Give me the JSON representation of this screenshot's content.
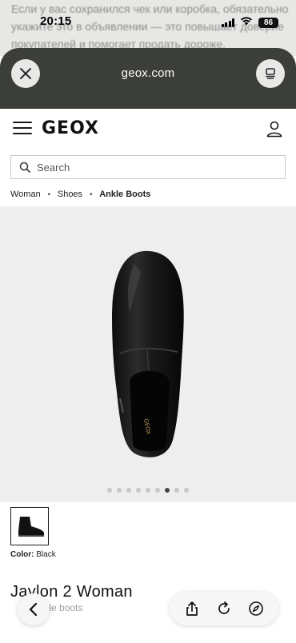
{
  "background_page": {
    "text": "Если у вас сохранился чек или коробка, обязательно укажите это в объявлении — это повышает доверие покупателей и помогает продать дороже."
  },
  "status_bar": {
    "time": "20:15",
    "battery": "86"
  },
  "browser": {
    "domain": "geox.com",
    "close_icon": "close-icon",
    "tabs_icon": "tabs-icon"
  },
  "site": {
    "logo": "GEOX",
    "search": {
      "placeholder": "Search"
    },
    "breadcrumb": [
      "Woman",
      "Shoes",
      "Ankle Boots"
    ]
  },
  "gallery": {
    "dot_count": 9,
    "active_dot": 7
  },
  "product": {
    "color_label": "Color:",
    "color_value": "Black",
    "title": "Jaylon 2 Woman",
    "subtitle": "ankle boots"
  },
  "colors": {
    "sheet": "#3c3e3a",
    "gallery_bg": "#eeeeee",
    "accent": "#1a1a1a"
  }
}
